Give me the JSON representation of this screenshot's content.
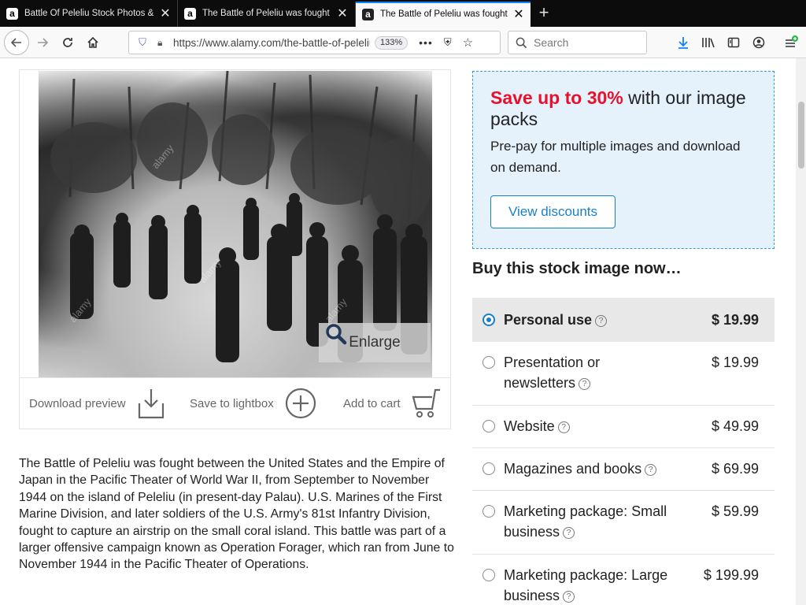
{
  "tabs": [
    {
      "title": "Battle Of Peleliu Stock Photos & Images",
      "favicon": "a",
      "active": false
    },
    {
      "title": "The Battle of Peleliu was fought between",
      "favicon": "a",
      "active": false
    },
    {
      "title": "The Battle of Peleliu was fought between",
      "favicon": "a",
      "active": true
    }
  ],
  "navbar": {
    "url": "https://www.alamy.com/the-battle-of-peleliu",
    "zoom": "133%",
    "more": "•••",
    "search_placeholder": "Search"
  },
  "image": {
    "enlarge_label": "Enlarge",
    "watermark": "alamy"
  },
  "actions": {
    "download": "Download preview",
    "lightbox": "Save to lightbox",
    "cart": "Add to cart"
  },
  "description": "The Battle of Peleliu was fought between the United States and the Empire of Japan in the Pacific Theater of World War II, from September to November 1944 on the island of Peleliu (in present-day Palau). U.S. Marines of the First Marine Division, and later soldiers of the U.S. Army's 81st Infantry Division, fought to capture an airstrip on the small coral island. This battle was part of a larger offensive campaign known as Operation Forager, which ran from June to November 1944 in the Pacific Theater of Operations.",
  "promo": {
    "highlight": "Save up to 30%",
    "headline_rest": " with our image packs",
    "text": "Pre-pay for multiple images and download on demand.",
    "button": "View discounts"
  },
  "buy_heading": "Buy this stock image now…",
  "options": [
    {
      "label": "Personal use",
      "price": "$ 19.99",
      "selected": true
    },
    {
      "label": "Presentation or newsletters",
      "price": "$ 19.99",
      "selected": false
    },
    {
      "label": "Website",
      "price": "$ 49.99",
      "selected": false
    },
    {
      "label": "Magazines and books",
      "price": "$ 69.99",
      "selected": false
    },
    {
      "label": "Marketing package: Small business",
      "price": "$ 59.99",
      "selected": false
    },
    {
      "label": "Marketing package: Large business",
      "price": "$ 199.99",
      "selected": false
    }
  ],
  "colors": {
    "accent_blue": "#1a7fc9",
    "promo_red": "#e8112d",
    "promo_bg": "#e6f2fb",
    "selected_bg": "#e8e8e8",
    "tabbar_bg": "#0c0c0d"
  }
}
